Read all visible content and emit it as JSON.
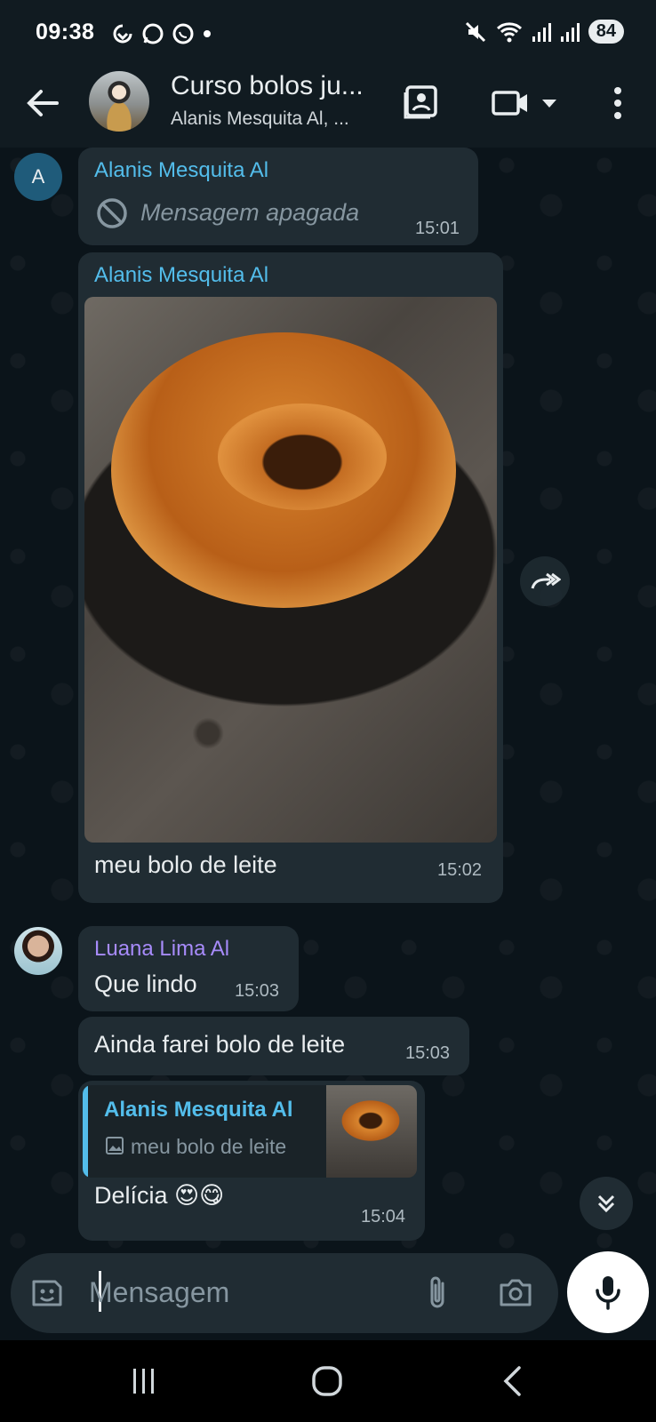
{
  "status_bar": {
    "time": "09:38",
    "battery": "84",
    "left_icons": [
      "sync-icon",
      "whatsapp-icon",
      "whatsapp-business-icon",
      "dot-icon"
    ],
    "right_icons": [
      "mute-icon",
      "wifi-icon",
      "signal-icon",
      "signal-icon",
      "battery-icon"
    ]
  },
  "header": {
    "title": "Curso bolos ju...",
    "subtitle": "Alanis Mesquita Al, ...",
    "icons": [
      "back-arrow-icon",
      "group-avatar",
      "contact-card-icon",
      "video-call-icon",
      "dropdown-icon",
      "more-options-icon"
    ]
  },
  "messages": [
    {
      "avatar_letter": "A",
      "sender": "Alanis Mesquita Al",
      "text": "Mensagem apagada",
      "time": "15:01"
    },
    {
      "sender": "Alanis Mesquita Al",
      "caption": "meu bolo de leite",
      "time": "15:02"
    },
    {
      "sender": "Luana Lima Al",
      "text": "Que lindo",
      "time": "15:03"
    },
    {
      "text": "Ainda farei bolo de leite",
      "time": "15:03"
    },
    {
      "quoted_sender": "Alanis Mesquita Al",
      "quoted_text": "meu bolo de leite",
      "text": "Delícia 😍😋",
      "time": "15:04"
    }
  ],
  "composer": {
    "placeholder": "Mensagem"
  },
  "colors": {
    "background": "#0b141a",
    "bubble": "#202c33",
    "header": "#111b21",
    "sender_blue": "#53bdeb",
    "sender_purple": "#a78bfa"
  }
}
